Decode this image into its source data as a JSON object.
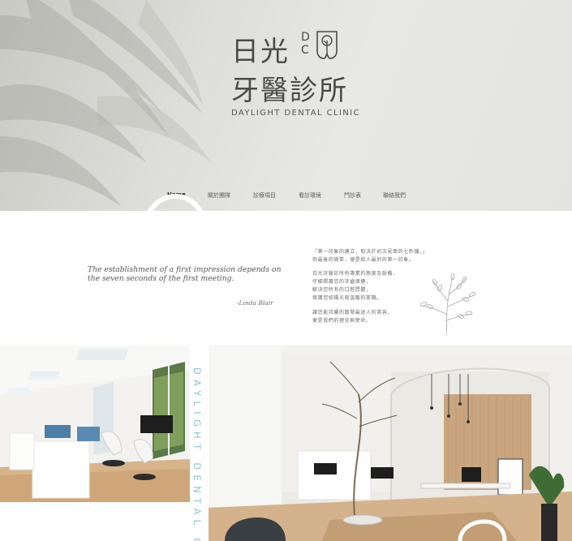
{
  "logo": {
    "line1": "日光",
    "dc": [
      "D",
      "C"
    ],
    "line2": "牙醫診所",
    "english": "DAYLIGHT DENTAL CLINIC"
  },
  "nav": {
    "items": [
      "Home",
      "關於團隊",
      "診療項目",
      "看診環境",
      "門診表",
      "聯絡我們"
    ],
    "active": "Home"
  },
  "quote": {
    "text": "The establishment of a first impression depends on the seven seconds of the first meeting.",
    "author": "-Linda Blair"
  },
  "intro_zh": [
    "「第一印象的建立，取決於初次見面的七秒鐘。」",
    "但最後的微笑，便是給人最好的第一印象。",
    "日光牙醫診所所專業的態度及設備，",
    "仔細照護您的牙齒保健，",
    "解決您所有的口腔問題，",
    "保護您如陽光般溫暖的笑顏。",
    "讓您能持續的散發最迷人的笑容，",
    "便是我們的理念與使命。"
  ],
  "vertical_text": "DAYLIGHT DENTAL CLINIC",
  "colors": {
    "hero_bg": "#e3e3df",
    "logo_text": "#4a4a48",
    "vertical_text": "#8fc1d0"
  }
}
